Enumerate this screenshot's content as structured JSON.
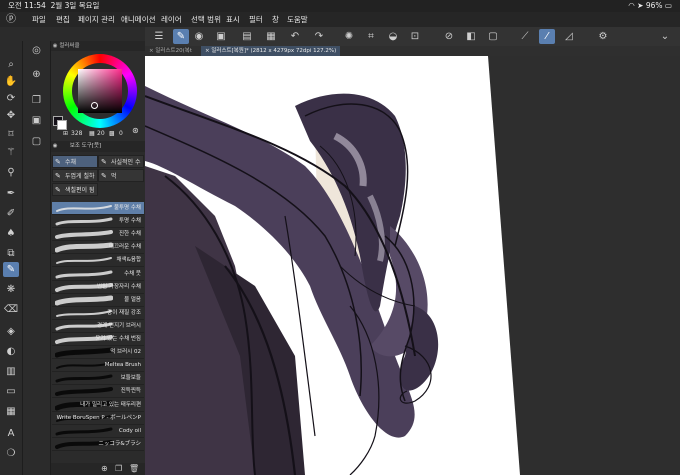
{
  "status": {
    "time": "오전 11:54",
    "date": "2월 3일 목요일",
    "battery": "96%"
  },
  "menu": [
    "파일",
    "편집",
    "페이지 관리",
    "애니메이션",
    "레이어",
    "선택 범위",
    "표시",
    "필터",
    "창",
    "도움말"
  ],
  "command_bar": {
    "icons": [
      "hamburger-icon",
      "pen-select-icon",
      "view-icon",
      "save-icon",
      "undo-icon",
      "redo-icon",
      "loading-icon",
      "crop-icon",
      "fill-icon",
      "transform-icon",
      "clear-icon",
      "invert-icon",
      "deselect-icon",
      "ruler-icon",
      "pen-line-icon",
      "shape-icon",
      "settings-icon"
    ]
  },
  "tabs": [
    {
      "label": "일러스트20(복t"
    },
    {
      "label": "일러스트[복원]* (2812 x 4279px 72dpi 127.2%)"
    }
  ],
  "color_panel": {
    "title": "컬러써클",
    "r": "328",
    "g": "20",
    "b": "0",
    "main_color": "#141018",
    "sub_color": "#ffffff"
  },
  "brush_panel": {
    "title": "보조 도구[붓]",
    "groups": [
      "수채",
      "사실적인 수",
      "두껍게 칠하",
      "먹",
      "색칠편이 됨"
    ],
    "brushes": [
      "불투명 수채",
      "투명 수채",
      "진한 수채",
      "매끄러운 수채",
      "채색&융합",
      "수채 붓",
      "번짐 가장자리 수채",
      "물 얼음",
      "종이 재질 강조",
      "경계 번지기 브러시",
      "윤기 있는 수채 번짐",
      "먹 브러시 02",
      "Meltea Brush",
      "보들보들",
      "진득찐득",
      "내가 밀리고 있는 태두리편",
      "Write BoruSpen P - ボールペンP",
      "Cody   oil",
      "ニッコラ&ブラシ"
    ]
  }
}
